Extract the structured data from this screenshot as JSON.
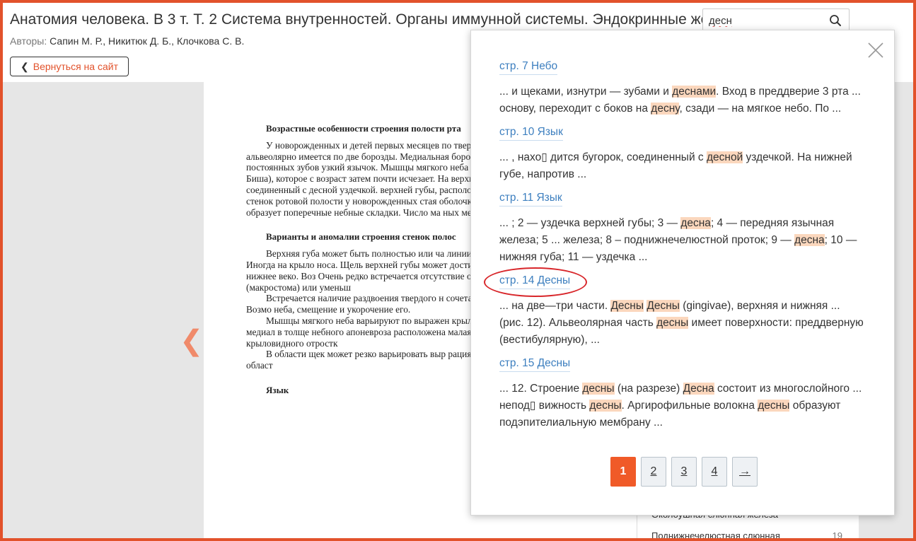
{
  "header": {
    "title": "Анатомия человека. В 3 т. Т. 2 Система внутренностей. Органы иммунной системы. Эндокринные железы",
    "authors_label": "Авторы:",
    "authors": "Сапин М. Р., Никитюк Д. Б., Клочкова С. В.",
    "back_label": "Вернуться на сайт"
  },
  "search": {
    "value": "десн",
    "icon": "search-icon"
  },
  "book_page": {
    "heading1": "Возрастные особенности строения полости рта",
    "p1": "У новорожденных и детей первых месяцев по твердое небо широкое, плоское. На альвеолярно имеется по две борозды. Медиальная борозда со бов, латеральная — зачаткам постоянных зубов узкий язычок. Мышцы мягкого неба достаточно жирового тела (комка Биша), которое с возраст затем почти исчезает. На верхней губе новорожд дится бугорок, соединенный с десной уздечкой. верхней губы, расположено вдавление, которое с лочка стенок ротовой полости у новорожденных стая оболочка губ и щек подвижная и тонкая, у образует поперечные небные складки. Число ма ных меньше, чем у взрослого человека.",
    "heading2": "Варианты и аномалии строения стенок полос",
    "p2": "Верхняя губа может быть полностью или ча линии или сбоку от нее («заячья губа»). Иногда на крыло носа. Щель верхней губы может достиг ходить до глазницы, разделять нижнее веко. Воз Очень редко встречается отсутствие одной или длины ротовой щели (макростома) или уменьш",
    "p3": "Встречается наличие раздвоения твердого н сочетаться с расщеплением мягкого неба. Возмо неба, смещение и укорочение его.",
    "p4": "Мышцы мягкого неба варьируют по выражен крыло-трубная мышца, начинающаяся на медиал в толще небного апоневроза расположена малая м начинающаяся от крючка крыловидного отростк",
    "p5": "В области щек может резко варьировать выр рация щеки, толщина щечной мышцы, област",
    "heading3": "Язык"
  },
  "toc_partial": [
    {
      "label": "Околоушная слюнная железа",
      "page": ""
    },
    {
      "label": "Поднижнечелюстная слюнная",
      "page": "19"
    }
  ],
  "results": [
    {
      "link": "стр. 7 Небо",
      "segments": [
        {
          "t": "... и щеками, изнутри — зубами и ",
          "h": false
        },
        {
          "t": "деснами",
          "h": true
        },
        {
          "t": ". Вход в преддверие 3 рта ... основу, переходит с боков на ",
          "h": false
        },
        {
          "t": "десну",
          "h": true
        },
        {
          "t": ", сзади — на мягкое небо. По ...",
          "h": false
        }
      ]
    },
    {
      "link": "стр. 10 Язык",
      "segments": [
        {
          "t": "... , нахо▯ дится бугорок, соединенный с ",
          "h": false
        },
        {
          "t": "десной",
          "h": true
        },
        {
          "t": " уздечкой. На нижней губе, напротив ...",
          "h": false
        }
      ]
    },
    {
      "link": "стр. 11 Язык",
      "segments": [
        {
          "t": "... ; 2 — уздечка верхней губы; 3 — ",
          "h": false
        },
        {
          "t": "десна",
          "h": true
        },
        {
          "t": "; 4 — передняя язычная железа; 5 ... железа; 8 – поднижнечелюстной проток; 9 — ",
          "h": false
        },
        {
          "t": "десна",
          "h": true
        },
        {
          "t": "; 10 — нижняя губа; 11 — уздечка ...",
          "h": false
        }
      ]
    },
    {
      "link": "стр. 14 Десны",
      "segments": [
        {
          "t": "... на две—три части. ",
          "h": false
        },
        {
          "t": "Десны",
          "h": true
        },
        {
          "t": " ",
          "h": false
        },
        {
          "t": "Десны",
          "h": true
        },
        {
          "t": " (gingivae), верхняя и нижняя ... (рис. 12). Альвеолярная часть ",
          "h": false
        },
        {
          "t": "десны",
          "h": true
        },
        {
          "t": " имеет поверхности: преддверную (вестибулярную), ...",
          "h": false
        }
      ]
    },
    {
      "link": "стр. 15 Десны",
      "segments": [
        {
          "t": "... 12. Строение ",
          "h": false
        },
        {
          "t": "десны",
          "h": true
        },
        {
          "t": " (на разрезе) ",
          "h": false
        },
        {
          "t": "Десна",
          "h": true
        },
        {
          "t": " состоит из многослойного ... непод▯ вижность ",
          "h": false
        },
        {
          "t": "десны",
          "h": true
        },
        {
          "t": ". Аргирофильные волокна ",
          "h": false
        },
        {
          "t": "десны",
          "h": true
        },
        {
          "t": " образуют подэпителиальную мембрану ...",
          "h": false
        }
      ]
    }
  ],
  "pagination": [
    "1",
    "2",
    "3",
    "4",
    "→"
  ],
  "colors": {
    "accent": "#f05a28",
    "link": "#3d7fbf",
    "highlight": "#fbd7bd",
    "annotation": "#d8262a"
  }
}
